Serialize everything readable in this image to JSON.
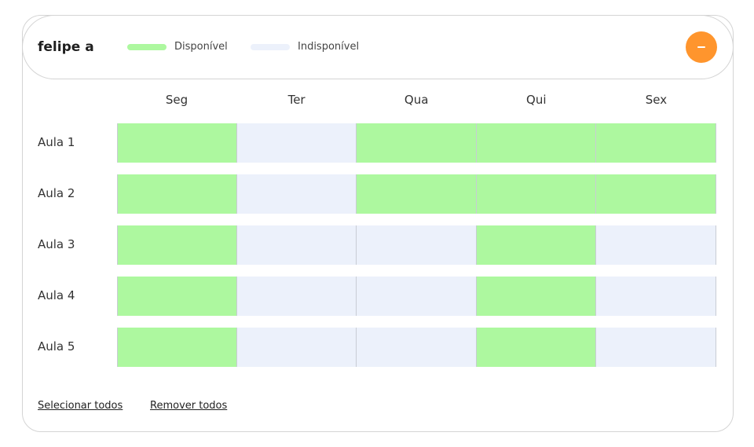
{
  "teacher": {
    "name": "felipe a"
  },
  "legend": {
    "available": {
      "label": "Disponível",
      "color": "#adf89f"
    },
    "unavailable": {
      "label": "Indisponível",
      "color": "#ecf1fb"
    }
  },
  "collapse_button": {
    "icon": "minus-icon",
    "color": "#ff952d"
  },
  "days": [
    "Seg",
    "Ter",
    "Qua",
    "Qui",
    "Sex"
  ],
  "lessons": [
    {
      "label": "Aula 1",
      "availability": [
        true,
        false,
        true,
        true,
        true
      ]
    },
    {
      "label": "Aula 2",
      "availability": [
        true,
        false,
        true,
        true,
        true
      ]
    },
    {
      "label": "Aula 3",
      "availability": [
        true,
        false,
        false,
        true,
        false
      ]
    },
    {
      "label": "Aula 4",
      "availability": [
        true,
        false,
        false,
        true,
        false
      ]
    },
    {
      "label": "Aula 5",
      "availability": [
        true,
        false,
        false,
        true,
        false
      ]
    }
  ],
  "footer": {
    "select_all": "Selecionar todos",
    "remove_all": "Remover todos"
  }
}
